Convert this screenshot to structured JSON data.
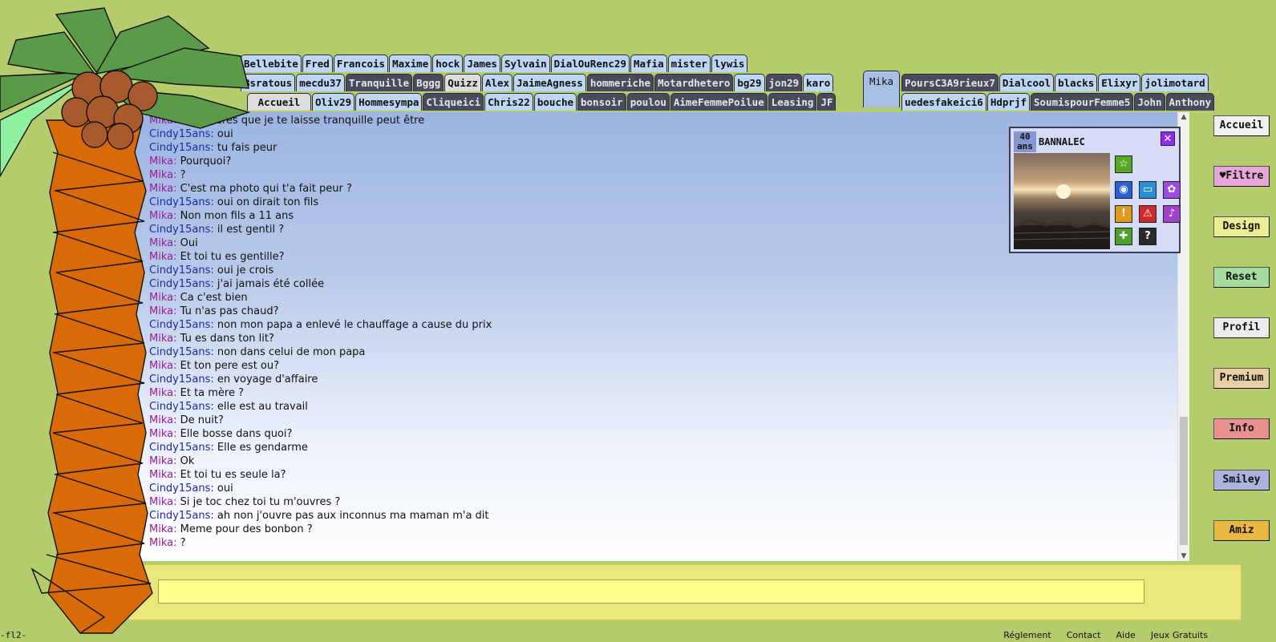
{
  "tabs": {
    "row1": [
      {
        "label": "Bellebite",
        "style": "normal"
      },
      {
        "label": "Fred",
        "style": "normal"
      },
      {
        "label": "Francois",
        "style": "normal"
      },
      {
        "label": "Maxime",
        "style": "normal"
      },
      {
        "label": "hock",
        "style": "normal"
      },
      {
        "label": "James",
        "style": "normal"
      },
      {
        "label": "Sylvain",
        "style": "normal"
      },
      {
        "label": "DialOuRenc29",
        "style": "normal"
      },
      {
        "label": "Mafia",
        "style": "normal"
      },
      {
        "label": "mister",
        "style": "normal"
      },
      {
        "label": "lywis",
        "style": "normal"
      }
    ],
    "row2": [
      {
        "label": "Bsratous",
        "style": "normal"
      },
      {
        "label": "mecdu37",
        "style": "normal"
      },
      {
        "label": "Tranquille",
        "style": "dark"
      },
      {
        "label": "Bggg",
        "style": "dark"
      },
      {
        "label": "Quizz",
        "style": "light"
      },
      {
        "label": "Alex",
        "style": "normal"
      },
      {
        "label": "JaimeAgness",
        "style": "normal"
      },
      {
        "label": "hommeriche",
        "style": "dark"
      },
      {
        "label": "Motardhetero",
        "style": "dark"
      },
      {
        "label": "bg29",
        "style": "normal"
      },
      {
        "label": "jon29",
        "style": "dark"
      },
      {
        "label": "karo",
        "style": "normal"
      }
    ],
    "row2b": [
      {
        "label": "PoursC3A9rieux7",
        "style": "dark"
      },
      {
        "label": "Dialcool",
        "style": "normal"
      },
      {
        "label": "blacks",
        "style": "normal"
      },
      {
        "label": "Elixyr",
        "style": "normal"
      },
      {
        "label": "jolimotard",
        "style": "normal"
      }
    ],
    "row3": [
      {
        "label": "Accueil",
        "style": "light"
      },
      {
        "label": "Oliv29",
        "style": "normal"
      },
      {
        "label": "Hommesympa",
        "style": "normal"
      },
      {
        "label": "Cliqueici",
        "style": "dark"
      },
      {
        "label": "Chris22",
        "style": "normal"
      },
      {
        "label": "bouche",
        "style": "normal"
      },
      {
        "label": "bonsoir",
        "style": "dark"
      },
      {
        "label": "poulou",
        "style": "dark"
      },
      {
        "label": "AimeFemmePoilue",
        "style": "dark"
      },
      {
        "label": "Leasing",
        "style": "dark"
      },
      {
        "label": "JF",
        "style": "dark"
      }
    ],
    "row3b": [
      {
        "label": "uedesfakeici6",
        "style": "normal"
      },
      {
        "label": "Hdprjf",
        "style": "normal"
      },
      {
        "label": "SoumispourFemme5",
        "style": "dark"
      },
      {
        "label": "John",
        "style": "dark"
      },
      {
        "label": "Anthony",
        "style": "dark"
      }
    ],
    "active": "Mika"
  },
  "messages": [
    {
      "nick": "Mika:",
      "text": "Tu préfères que je te laisse tranquille peut être",
      "sex": "m"
    },
    {
      "nick": "Cindy15ans:",
      "text": "oui",
      "sex": "f"
    },
    {
      "nick": "Cindy15ans:",
      "text": "tu fais peur",
      "sex": "f"
    },
    {
      "nick": "Mika:",
      "text": "Pourquoi?",
      "sex": "m"
    },
    {
      "nick": "Mika:",
      "text": "?",
      "sex": "m"
    },
    {
      "nick": "Mika:",
      "text": "C'est ma photo qui t'a fait peur ?",
      "sex": "m"
    },
    {
      "nick": "Cindy15ans:",
      "text": "oui on dirait ton fils",
      "sex": "f"
    },
    {
      "nick": "Mika:",
      "text": "Non mon fils a 11 ans",
      "sex": "m"
    },
    {
      "nick": "Cindy15ans:",
      "text": "il est gentil ?",
      "sex": "f"
    },
    {
      "nick": "Mika:",
      "text": "Oui",
      "sex": "m"
    },
    {
      "nick": "Mika:",
      "text": "Et toi tu es gentille?",
      "sex": "m"
    },
    {
      "nick": "Cindy15ans:",
      "text": "oui je crois",
      "sex": "f"
    },
    {
      "nick": "Cindy15ans:",
      "text": "j'ai jamais été collée",
      "sex": "f"
    },
    {
      "nick": "Mika:",
      "text": "Ca c'est bien",
      "sex": "m"
    },
    {
      "nick": "Mika:",
      "text": "Tu n'as pas chaud?",
      "sex": "m"
    },
    {
      "nick": "Cindy15ans:",
      "text": "non mon papa a enlevé le chauffage a cause du prix",
      "sex": "f"
    },
    {
      "nick": "Mika:",
      "text": "Tu es dans ton lit?",
      "sex": "m"
    },
    {
      "nick": "Cindy15ans:",
      "text": "non dans celui de mon papa",
      "sex": "f"
    },
    {
      "nick": "Mika:",
      "text": "Et ton pere est ou?",
      "sex": "m"
    },
    {
      "nick": "Cindy15ans:",
      "text": "en voyage d'affaire",
      "sex": "f"
    },
    {
      "nick": "Mika:",
      "text": "Et ta mère ?",
      "sex": "m"
    },
    {
      "nick": "Cindy15ans:",
      "text": "elle est au travail",
      "sex": "f"
    },
    {
      "nick": "Mika:",
      "text": "De nuit?",
      "sex": "m"
    },
    {
      "nick": "Mika:",
      "text": "Elle bosse dans quoi?",
      "sex": "m"
    },
    {
      "nick": "Cindy15ans:",
      "text": "Elle es gendarme",
      "sex": "f"
    },
    {
      "nick": "Mika:",
      "text": "Ok",
      "sex": "m"
    },
    {
      "nick": "Mika:",
      "text": "Et toi tu es seule la?",
      "sex": "m"
    },
    {
      "nick": "Cindy15ans:",
      "text": "oui",
      "sex": "f"
    },
    {
      "nick": "Mika:",
      "text": "Si je toc chez toi tu m'ouvres ?",
      "sex": "m"
    },
    {
      "nick": "Cindy15ans:",
      "text": "ah non j'ouvre pas aux inconnus ma maman m'a dit",
      "sex": "f"
    },
    {
      "nick": "Mika:",
      "text": "Meme pour des bonbon ?",
      "sex": "m"
    },
    {
      "nick": "Mika:",
      "text": "?",
      "sex": "m"
    }
  ],
  "profile_card": {
    "age_number": "40",
    "age_unit": "ans",
    "city": "BANNALEC",
    "close": "✕",
    "buttons": [
      {
        "name": "favorite-star-icon",
        "glyph": "☆",
        "color": "#5aa628"
      },
      {
        "name": "webcam-icon",
        "glyph": "◉",
        "color": "#2a5fd6"
      },
      {
        "name": "gallery-icon",
        "glyph": "▭",
        "color": "#2a8fd6"
      },
      {
        "name": "flower-icon",
        "glyph": "✿",
        "color": "#9b4be0"
      },
      {
        "name": "info-icon",
        "glyph": "!",
        "color": "#e09a1a"
      },
      {
        "name": "warning-icon",
        "glyph": "⚠",
        "color": "#d22a2a"
      },
      {
        "name": "microphone-icon",
        "glyph": "♪",
        "color": "#a042c8"
      },
      {
        "name": "add-friend-icon",
        "glyph": "✚",
        "color": "#4aa028"
      },
      {
        "name": "help-icon",
        "glyph": "?",
        "color": "#2a2a2a"
      }
    ]
  },
  "sidebar": [
    {
      "label": "Accueil",
      "color": "#f0f0f0"
    },
    {
      "label": "♥Filtre",
      "color": "#e6a8d8"
    },
    {
      "label": "Design",
      "color": "#ecec92"
    },
    {
      "label": "Reset",
      "color": "#a6dca0"
    },
    {
      "label": "Profil",
      "color": "#ececec"
    },
    {
      "label": "Premium",
      "color": "#e8d0a4"
    },
    {
      "label": "Info",
      "color": "#e99090"
    },
    {
      "label": "Smiley",
      "color": "#aab4dc"
    },
    {
      "label": "Amiz",
      "color": "#e8b840"
    }
  ],
  "input": {
    "value": ""
  },
  "footer": {
    "left": "-fl2-",
    "links": [
      "Réglement",
      "Contact",
      "Aide",
      "Jeux Gratuits"
    ]
  }
}
